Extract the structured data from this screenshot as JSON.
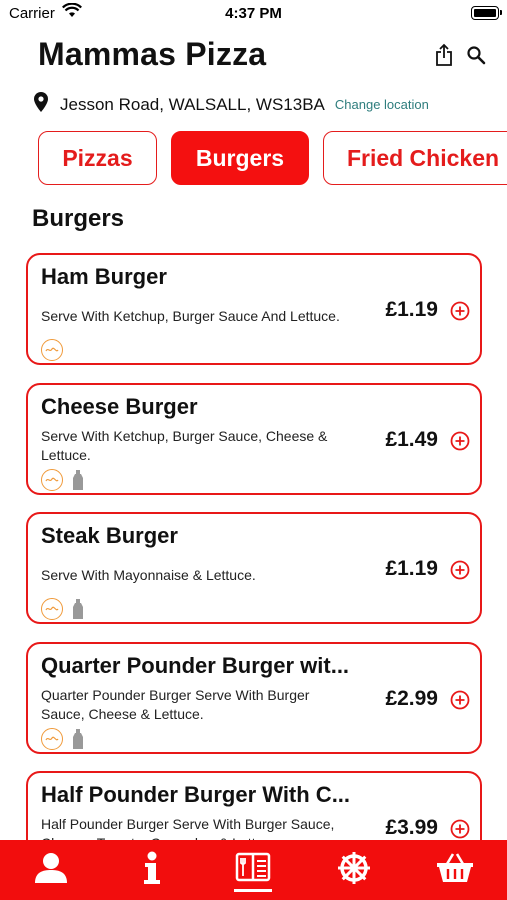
{
  "status_bar": {
    "carrier": "Carrier",
    "time": "4:37 PM"
  },
  "header": {
    "title": "Mammas Pizza",
    "share_icon": "share-icon",
    "search_icon": "search-icon"
  },
  "location": {
    "address": "Jesson Road, WALSALL, WS13BA",
    "change_label": "Change location",
    "icon": "location-pin-icon"
  },
  "categories": [
    {
      "label": "Pizzas",
      "active": false
    },
    {
      "label": "Burgers",
      "active": true
    },
    {
      "label": "Fried Chicken",
      "active": false
    }
  ],
  "section_title": "Burgers",
  "items": [
    {
      "name": "Ham Burger",
      "description": "Serve With Ketchup, Burger Sauce And Lettuce.",
      "price": "£1.19",
      "halal": true,
      "sauce": false
    },
    {
      "name": "Cheese Burger",
      "description": "Serve With Ketchup, Burger Sauce, Cheese & Lettuce.",
      "price": "£1.49",
      "halal": true,
      "sauce": true
    },
    {
      "name": "Steak Burger",
      "description": "Serve With Mayonnaise & Lettuce.",
      "price": "£1.19",
      "halal": true,
      "sauce": true
    },
    {
      "name": "Quarter Pounder Burger wit...",
      "description": "Quarter Pounder Burger  Serve With Burger Sauce, Cheese & Lettuce.",
      "price": "£2.99",
      "halal": true,
      "sauce": true
    },
    {
      "name": "Half Pounder Burger With C...",
      "description": "Half Pounder Burger Serve With Burger Sauce, Cheese, Tomato, Cucumber & Lettuce.",
      "price": "£3.99",
      "halal": false,
      "sauce": false
    }
  ],
  "tab_bar": {
    "tabs": [
      {
        "icon": "profile-icon",
        "active": false
      },
      {
        "icon": "info-icon",
        "active": false
      },
      {
        "icon": "menu-icon",
        "active": true
      },
      {
        "icon": "settings-wheel-icon",
        "active": false
      },
      {
        "icon": "basket-icon",
        "active": false
      }
    ]
  },
  "colors": {
    "accent": "#f20d0d",
    "card_border": "#e81818",
    "link": "#2e7d7d",
    "halal": "#f09a3a"
  }
}
